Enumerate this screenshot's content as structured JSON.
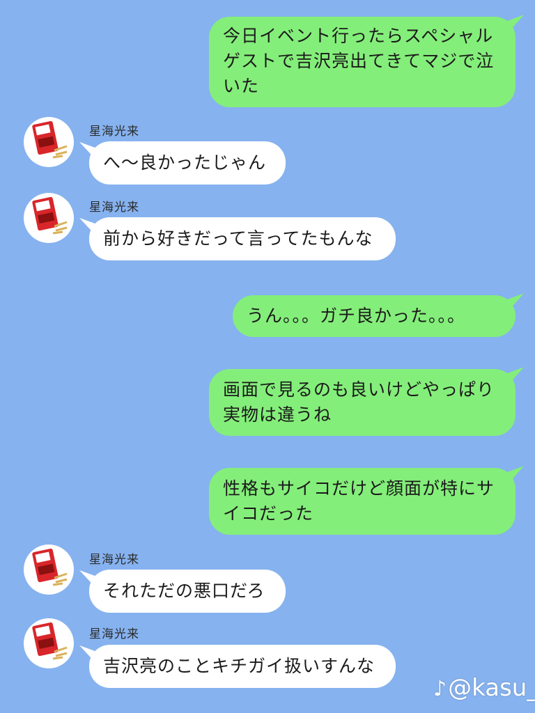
{
  "chat": {
    "contact_name": "星海光来",
    "messages": [
      {
        "side": "sent",
        "lines": [
          "今日イベント行ったらスペシャル",
          "ゲストで吉沢亮出てきてマジで泣",
          "いた"
        ]
      },
      {
        "side": "recv",
        "sender": "星海光来",
        "lines": [
          "へ〜良かったじゃん"
        ]
      },
      {
        "side": "recv",
        "sender": "星海光来",
        "lines": [
          "前から好きだって言ってたもんな"
        ]
      },
      {
        "side": "sent",
        "lines": [
          "うん。。。ガチ良かった。。。"
        ]
      },
      {
        "side": "sent",
        "lines": [
          "画面で見るのも良いけどやっぱり",
          "実物は違うね"
        ]
      },
      {
        "side": "sent",
        "lines": [
          "性格もサイコだけど顔面が特にサ",
          "イコだった"
        ]
      },
      {
        "side": "recv",
        "sender": "星海光来",
        "lines": [
          "それただの悪口だろ"
        ]
      },
      {
        "side": "recv",
        "sender": "星海光来",
        "lines": [
          "吉沢亮のことキチガイ扱いすんな"
        ]
      }
    ]
  },
  "watermark": {
    "icon": "tiktok-icon",
    "text": "@kasu_"
  },
  "colors": {
    "background": "#86b2ef",
    "sent_bubble": "#84ee7a",
    "recv_bubble": "#ffffff"
  }
}
